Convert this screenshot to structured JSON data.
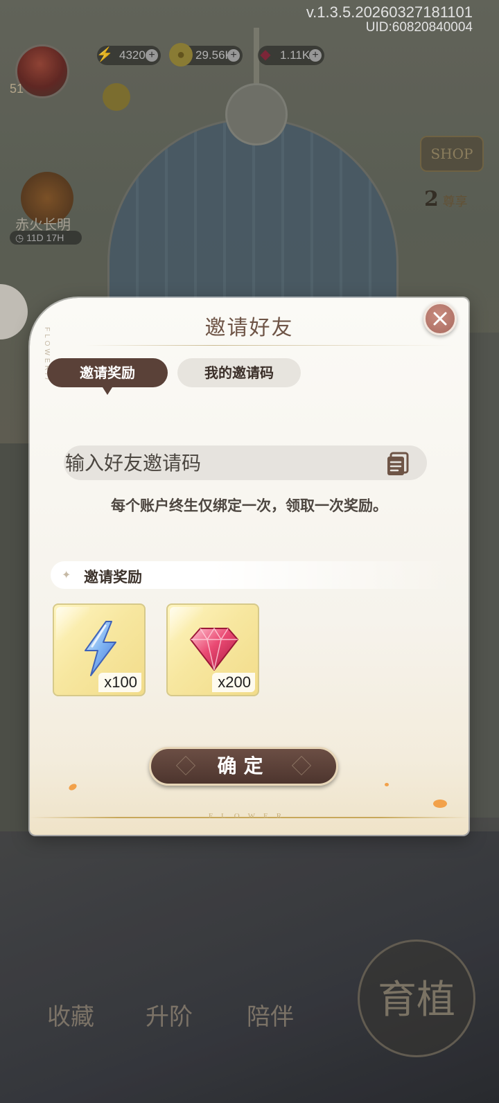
{
  "app": {
    "version": "v.1.3.5.20260327181101",
    "uid": "UID:60820840004"
  },
  "hud": {
    "player_level": "51",
    "resources": [
      {
        "name": "energy",
        "icon": "lightning-icon",
        "value": "4320"
      },
      {
        "name": "gold",
        "icon": "coin-icon",
        "value": "29.56K"
      },
      {
        "name": "gems",
        "icon": "gem-icon",
        "value": "1.11K"
      }
    ],
    "event": {
      "name": "赤火长明",
      "timer": "11D 17H"
    },
    "shop_label": "SHOP",
    "rank": {
      "number": "2",
      "label": "尊享"
    }
  },
  "bottom_nav": [
    {
      "label": "收藏"
    },
    {
      "label": "升阶"
    },
    {
      "label": "陪伴"
    }
  ],
  "merge_button": {
    "label": "育植"
  },
  "dialog": {
    "title": "邀请好友",
    "side_text": "FLOWER//",
    "tabs": [
      {
        "label": "邀请奖励",
        "active": true
      },
      {
        "label": "我的邀请码",
        "active": false
      }
    ],
    "input": {
      "placeholder": "输入好友邀请码",
      "value": ""
    },
    "hint": "每个账户终生仅绑定一次，领取一次奖励。",
    "rewards_section_title": "邀请奖励",
    "rewards": [
      {
        "icon": "lightning-icon",
        "quantity": "x100"
      },
      {
        "icon": "gem-icon",
        "quantity": "x200"
      }
    ],
    "confirm_label": "确定",
    "footer_text": "FLOWER"
  },
  "colors": {
    "accent_dark": "#5a4138",
    "tab_inactive": "#e7e4de",
    "close": "#a86a5f",
    "reward_bg": "#f7e7a0"
  }
}
